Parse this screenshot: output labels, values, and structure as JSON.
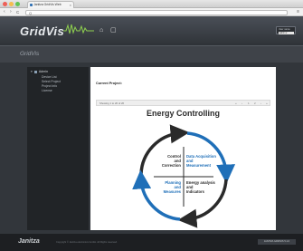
{
  "browser": {
    "tab_title": "Janitza GridVis Web",
    "tab_close": "×",
    "url": "Q",
    "back": "‹",
    "forward": "›",
    "reload": "C",
    "menu": "≡"
  },
  "header": {
    "logo": "GridVis",
    "home_icon": "⌂",
    "window_icon": "▢",
    "user_top": "User name",
    "user_select": "admin ▾"
  },
  "subheader": {
    "title": "GridVis"
  },
  "sidebar": {
    "root_label": "Admin",
    "items": [
      {
        "label": "Device List"
      },
      {
        "label": "Select Project"
      },
      {
        "label": "Project Info"
      },
      {
        "label": "License"
      }
    ]
  },
  "content": {
    "project_label": "Current Project:",
    "pdf_status": "Showing 1 to 20 of 26",
    "pdf_controls": [
      "«",
      "‹",
      "1",
      "2",
      "›",
      "»"
    ]
  },
  "document": {
    "title": "Energy Controlling",
    "labels": {
      "control": [
        "Control",
        "and",
        "Correction"
      ],
      "data": [
        "Data Acquisition",
        "and",
        "Measurement"
      ],
      "planning": [
        "Planning",
        "and",
        "Measures"
      ],
      "energy": [
        "Energy analysis",
        "and",
        "Indicators"
      ]
    },
    "colors": {
      "blue": "#1f6fb8",
      "dark": "#2a2a2a"
    }
  },
  "footer": {
    "brand": "Janitza",
    "copyright": "Copyright © Janitza electronics GmbH. All Rights reserved.",
    "version": "JANITZA GRIDVIS 5.1.0"
  }
}
